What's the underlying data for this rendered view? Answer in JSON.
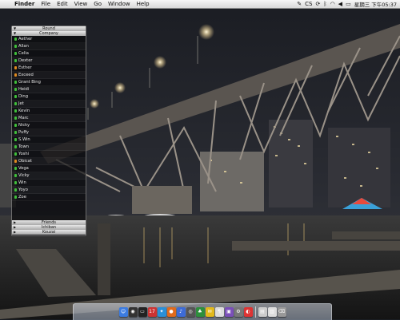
{
  "menubar": {
    "apple_glyph": "",
    "items": [
      "Finder",
      "File",
      "Edit",
      "View",
      "Go",
      "Window",
      "Help"
    ],
    "status_icons": [
      "script-icon",
      "cs-icon",
      "sync-icon",
      "bluetooth-icon",
      "wifi-icon",
      "volume-icon",
      "battery-icon"
    ],
    "cs_label": "CS",
    "clock": "星期三 下午05:37"
  },
  "buddy_list": {
    "groups": {
      "top": "Round",
      "company": "Company",
      "friends": "Friends",
      "ichiban": "Ichiban",
      "kouzai": "Kouzai"
    },
    "buddies": [
      {
        "name": "Aether",
        "status": "green"
      },
      {
        "name": "Allan",
        "status": "green"
      },
      {
        "name": "Celia",
        "status": "green"
      },
      {
        "name": "Dexter",
        "status": "green"
      },
      {
        "name": "Esther",
        "status": "orange"
      },
      {
        "name": "Exceed",
        "status": "orange"
      },
      {
        "name": "Grant Bing",
        "status": "green"
      },
      {
        "name": "Heidi",
        "status": "green"
      },
      {
        "name": "Ding",
        "status": "green"
      },
      {
        "name": "Jet",
        "status": "green"
      },
      {
        "name": "Kevin",
        "status": "green"
      },
      {
        "name": "Marc",
        "status": "green"
      },
      {
        "name": "Nicky",
        "status": "green"
      },
      {
        "name": "Puffy",
        "status": "green"
      },
      {
        "name": "S.Win",
        "status": "green"
      },
      {
        "name": "Town",
        "status": "green"
      },
      {
        "name": "Yoshi",
        "status": "green"
      },
      {
        "name": "Obicat",
        "status": "orange"
      },
      {
        "name": "Vega",
        "status": "green"
      },
      {
        "name": "Vicky",
        "status": "green"
      },
      {
        "name": "Win",
        "status": "green"
      },
      {
        "name": "Yoyo",
        "status": "green"
      },
      {
        "name": "Zoe",
        "status": "green"
      }
    ],
    "footer": "+ Options"
  },
  "dock": {
    "items": [
      {
        "name": "finder-icon",
        "glyph": "☺",
        "color": "#3b7be0"
      },
      {
        "name": "dashboard-icon",
        "glyph": "◉",
        "color": "#333"
      },
      {
        "name": "terminal-icon",
        "glyph": "▭",
        "color": "#222"
      },
      {
        "name": "ical-icon",
        "glyph": "17",
        "color": "#c33"
      },
      {
        "name": "safari-icon",
        "glyph": "✦",
        "color": "#2a8fd8"
      },
      {
        "name": "firefox-icon",
        "glyph": "●",
        "color": "#e06a1c"
      },
      {
        "name": "itunes-icon",
        "glyph": "♪",
        "color": "#3d6bd6"
      },
      {
        "name": "network-icon",
        "glyph": "◎",
        "color": "#555"
      },
      {
        "name": "adium-icon",
        "glyph": "♣",
        "color": "#2d8f3c"
      },
      {
        "name": "chat-icon",
        "glyph": "✉",
        "color": "#e2b91c"
      },
      {
        "name": "textedit-icon",
        "glyph": "¶",
        "color": "#ddd"
      },
      {
        "name": "photo-icon",
        "glyph": "▣",
        "color": "#7a4fb8"
      },
      {
        "name": "preferences-icon",
        "glyph": "⚙",
        "color": "#777"
      },
      {
        "name": "colorsync-icon",
        "glyph": "◐",
        "color": "#d33"
      }
    ],
    "right_items": [
      {
        "name": "documents-icon",
        "glyph": "▤",
        "color": "#ccc"
      },
      {
        "name": "downloads-icon",
        "glyph": "▥",
        "color": "#ddd"
      },
      {
        "name": "trash-icon",
        "glyph": "⌫",
        "color": "#999"
      }
    ]
  },
  "colors": {
    "status_green": "#3fbf3a",
    "status_orange": "#e08a1e",
    "menubar_bg": "#e8e8e8"
  }
}
